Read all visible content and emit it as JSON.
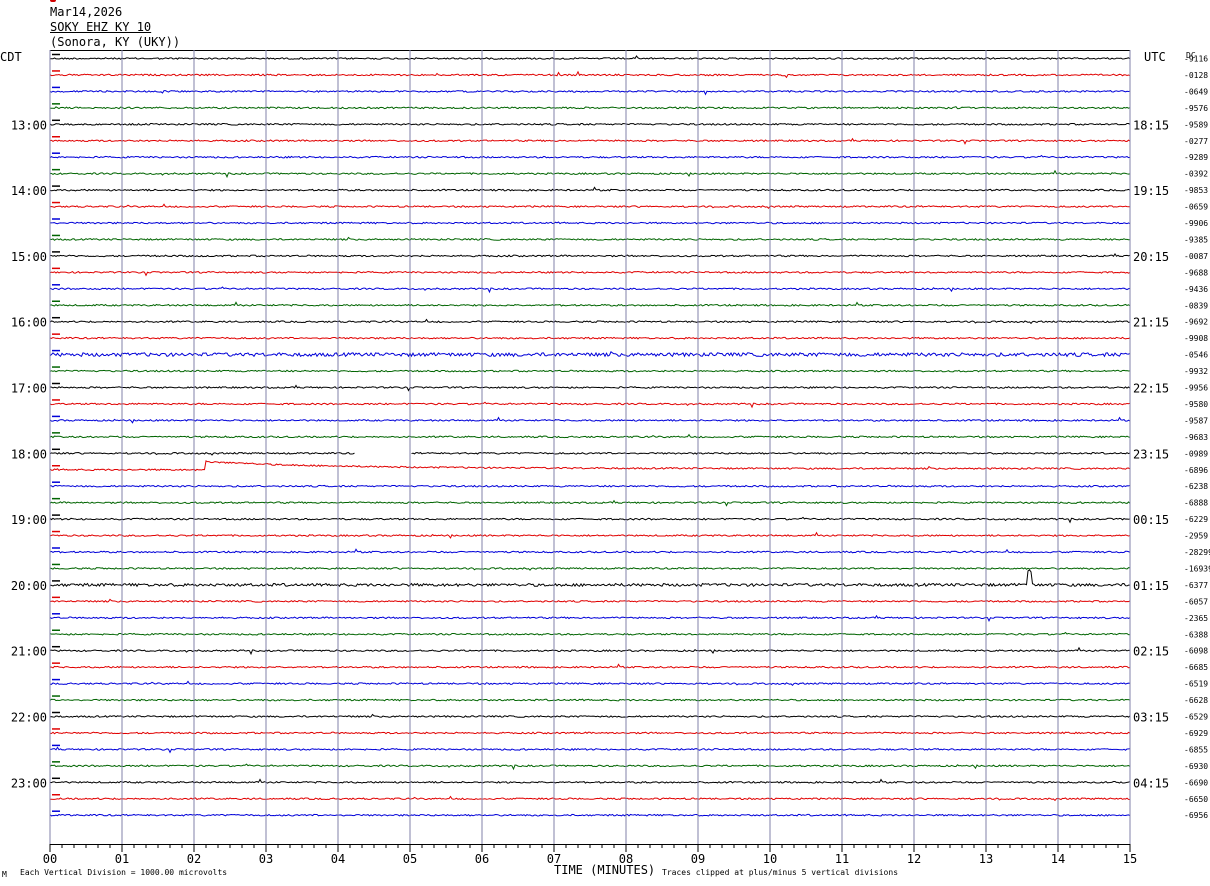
{
  "header": {
    "date": "Mar14,2026",
    "station": "SOKY EHZ KY 10",
    "location": "(Sonora, KY (UKY))"
  },
  "left_tz": "CDT",
  "right_tz": "UTC",
  "dc_label": "DC",
  "colors": {
    "trace_black": "#000000",
    "trace_red": "#e00000",
    "trace_blue": "#0000d8",
    "trace_green": "#006400",
    "grid": "#8080a8"
  },
  "footer": {
    "scale_note": "Each Vertical Division = 1000.00 microvolts",
    "clip_note": "Traces clipped at plus/minus 5 vertical divisions",
    "logo_glyph": "M"
  },
  "chart_data": {
    "type": "line",
    "title": "SOKY EHZ KY 10",
    "xlabel": "TIME (MINUTES)",
    "ylabel": "",
    "x_ticks": [
      "00",
      "01",
      "02",
      "03",
      "04",
      "05",
      "06",
      "07",
      "08",
      "09",
      "10",
      "11",
      "12",
      "13",
      "14",
      "15"
    ],
    "xlim": [
      0,
      15
    ],
    "trace_colors_cycle": [
      "black",
      "red",
      "blue",
      "green"
    ],
    "hour_labels_cdt": [
      "13:00",
      "14:00",
      "15:00",
      "16:00",
      "17:00",
      "18:00",
      "19:00",
      "20:00",
      "21:00",
      "22:00",
      "23:00"
    ],
    "hour_labels_utc": [
      "18:15",
      "19:15",
      "20:15",
      "21:15",
      "22:15",
      "23:15",
      "00:15",
      "01:15",
      "02:15",
      "03:15",
      "04:15"
    ],
    "dc_offsets": [
      "-9116",
      "-0128",
      "-0649",
      "-9576",
      "-9589",
      "-0277",
      "-9289",
      "-0392",
      "-9853",
      "-0659",
      "-9906",
      "-9385",
      "-0087",
      "-9688",
      "-9436",
      "-0839",
      "-9692",
      "-9908",
      "-0546",
      "-9932",
      "-9956",
      "-9580",
      "-9587",
      "-9683",
      "-0989",
      "-6896",
      "-6238",
      "-6888",
      "-6229",
      "-2959",
      "-28299",
      "-16939",
      "-6377",
      "-6057",
      "-2365",
      "-6388",
      "-6098",
      "-6685",
      "-6519",
      "-6628",
      "-6529",
      "-6929",
      "-6855",
      "-6930",
      "-6690",
      "-6650",
      "-6956"
    ],
    "events": [
      {
        "trace": 25,
        "minute": 2.15,
        "description": "step offset with slow decay"
      },
      {
        "trace": 24,
        "minute_start": 4.25,
        "minute_end": 5.0,
        "description": "data gap"
      },
      {
        "trace": 32,
        "minute": 13.6,
        "description": "spike"
      }
    ]
  }
}
